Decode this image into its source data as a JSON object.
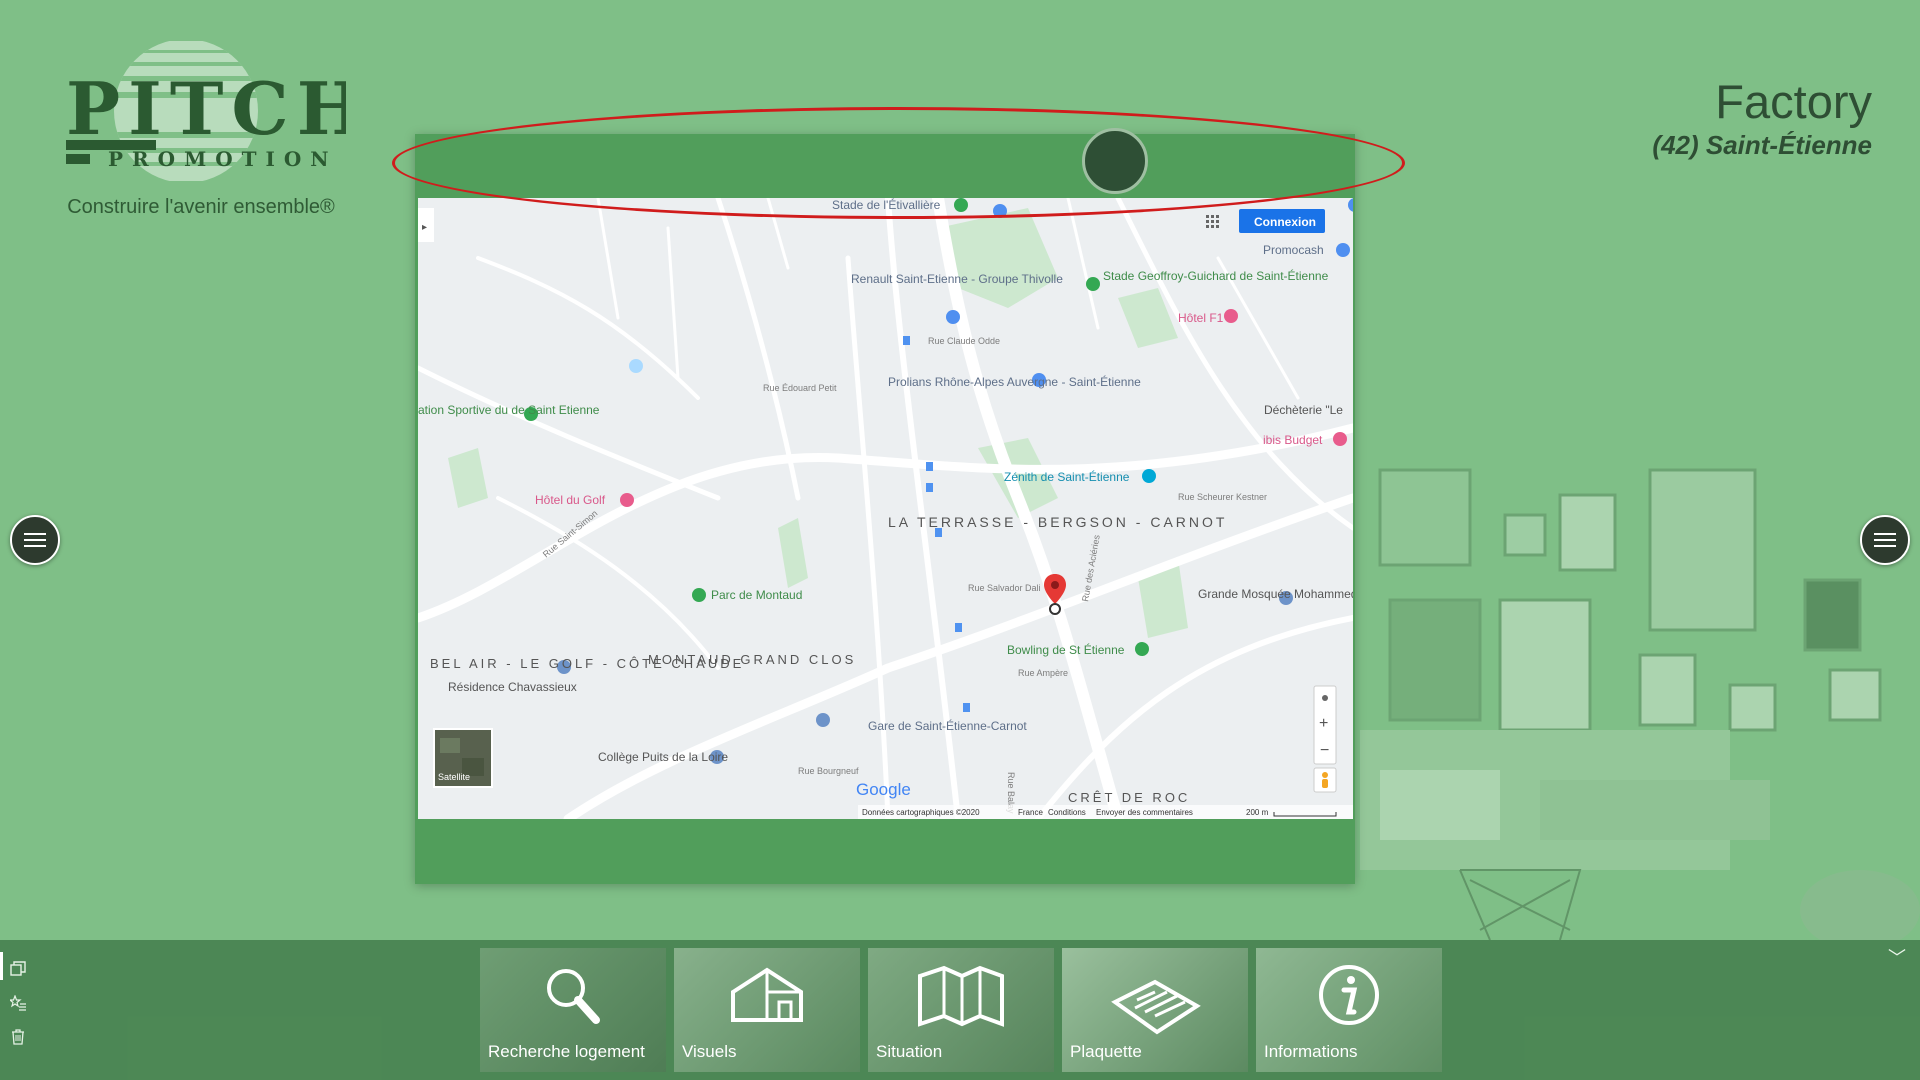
{
  "brand": {
    "logo_top": "PITCH",
    "logo_bottom": "PROMOTION",
    "slogan": "Construire l'avenir ensemble®"
  },
  "project": {
    "name": "Factory",
    "city": "(42) Saint-Étienne"
  },
  "map": {
    "connect_label": "Connexion",
    "satellite_label": "Satellite",
    "google_label": "Google",
    "footer": {
      "data": "Données cartographiques ©2020",
      "country": "France",
      "terms": "Conditions",
      "feedback": "Envoyer des commentaires",
      "scale": "200 m"
    },
    "places": [
      "Stade de l'Étivallière",
      "Promocash",
      "Renault Saint-Etienne - Groupe Thivolle",
      "Stade Geoffroy-Guichard de Saint-Étienne",
      "Hôtel F1",
      "Prolians Rhône-Alpes Auvergne - Saint-Étienne",
      "Déchèterie \"Le",
      "ibis Budget",
      "ation Sportive du de Saint Etienne",
      "Zénith de Saint-Étienne",
      "Hôtel du Golf",
      "LA TERRASSE - BERGSON - CARNOT",
      "Grande Mosquée Mohammed VI de...",
      "Parc de Montaud",
      "BEL AIR - LE GOLF - CÔTE CHAUDE",
      "MONTAUD GRAND CLOS",
      "Résidence Chavassieux",
      "Bowling de St Étienne",
      "Gare de Saint-Étienne-Carnot",
      "Collège Puits de la Loire",
      "CRÊT DE ROC"
    ],
    "streets": [
      "Rue Scheurer Kestner",
      "Rue Saint-Simon",
      "Rue Ampère",
      "Rue Bourgneuf",
      "Rue Salvador Dali",
      "Rue Édouard Petit",
      "Rue Claude Odde",
      "Rue Balay",
      "Rue des Aciéries"
    ]
  },
  "toolbar": {
    "items": [
      {
        "label": "Recherche logement",
        "icon": "search-icon"
      },
      {
        "label": "Visuels",
        "icon": "house-icon"
      },
      {
        "label": "Situation",
        "icon": "map-icon"
      },
      {
        "label": "Plaquette",
        "icon": "brochure-icon"
      },
      {
        "label": "Informations",
        "icon": "info-icon"
      }
    ]
  },
  "colors": {
    "background": "#7fbf87",
    "modal": "#519e5b",
    "accent_dark": "#2e4f35",
    "highlight": "#d01c1c",
    "connect_button": "#1a73e8"
  }
}
